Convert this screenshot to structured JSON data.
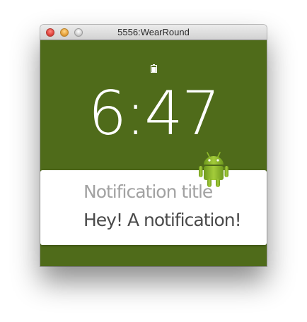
{
  "window": {
    "title": "5556:WearRound"
  },
  "watch": {
    "time": "6:47",
    "background_color": "#4f6b1a",
    "battery_icon": "battery-icon"
  },
  "notification": {
    "title": "Notification title",
    "text": "Hey! A notification!",
    "app_icon": "android-robot-icon"
  }
}
